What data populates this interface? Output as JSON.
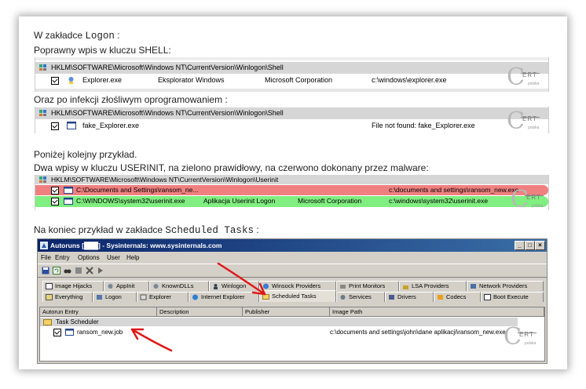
{
  "intro": {
    "logon_prefix": "W zakładce ",
    "logon_tab": "Logon",
    "logon_suffix": " :",
    "correct_entry": "Poprawny wpis w kluczu SHELL:",
    "infected": "Oraz po infekcji złośliwym oprogramowaniem :",
    "next_example": "Poniżej kolejny przykład.",
    "two_entries": "Dwa wpisy w kluczu USERINIT, na zielono prawidłowy, na czerwono dokonany przez malware:",
    "scheduled_prefix": "Na koniec przykład w zakładce ",
    "scheduled_tab": "Scheduled Tasks",
    "scheduled_suffix": " :"
  },
  "shell_ok": {
    "key": "HKLM\\SOFTWARE\\Microsoft\\Windows NT\\CurrentVersion\\Winlogon\\Shell",
    "entry": "Explorer.exe",
    "description": "Eksplorator Windows",
    "publisher": "Microsoft Corporation",
    "path": "c:\\windows\\explorer.exe"
  },
  "shell_bad": {
    "key": "HKLM\\SOFTWARE\\Microsoft\\Windows NT\\CurrentVersion\\Winlogon\\Shell",
    "entry": "fake_Explorer.exe",
    "path": "File not found: fake_Explorer.exe"
  },
  "userinit": {
    "key": "HKLM\\SOFTWARE\\Microsoft\\Windows NT\\CurrentVersion\\Winlogon\\Userinit",
    "bad_entry": "C:\\Documents and Settings\\ransom_ne...",
    "bad_path": "c:\\documents and settings\\ransom_new.exe",
    "good_entry": "C:\\WINDOWS\\system32\\userinit.exe",
    "good_description": "Aplikacja Userinit Logon",
    "good_publisher": "Microsoft Corporation",
    "good_path": "c:\\windows\\system32\\userinit.exe",
    "bad_color": "#f08080",
    "good_color": "#80ee80"
  },
  "autoruns": {
    "title": "Autoruns [███] - Sysinternals: www.sysinternals.com",
    "menu": [
      "File",
      "Entry",
      "Options",
      "User",
      "Help"
    ],
    "tabs_row1": [
      "Image Hijacks",
      "AppInit",
      "KnownDLLs",
      "Winlogon",
      "Winsock Providers",
      "Print Monitors",
      "LSA Providers",
      "Network Providers"
    ],
    "tabs_row2": [
      "Everything",
      "Logon",
      "Explorer",
      "Internet Explorer",
      "Scheduled Tasks",
      "Services",
      "Drivers",
      "Codecs",
      "Boot Execute"
    ],
    "columns": [
      "Autorun Entry",
      "Description",
      "Publisher",
      "Image Path"
    ],
    "group": "Task Scheduler",
    "task_entry": "ransom_new.job",
    "task_path": "c:\\documents and settings\\john\\dane aplikacji\\ransom_new.exe",
    "titlebar_color": "#0a246a"
  },
  "watermark": {
    "letters": "ERT",
    "sub": "polska"
  }
}
